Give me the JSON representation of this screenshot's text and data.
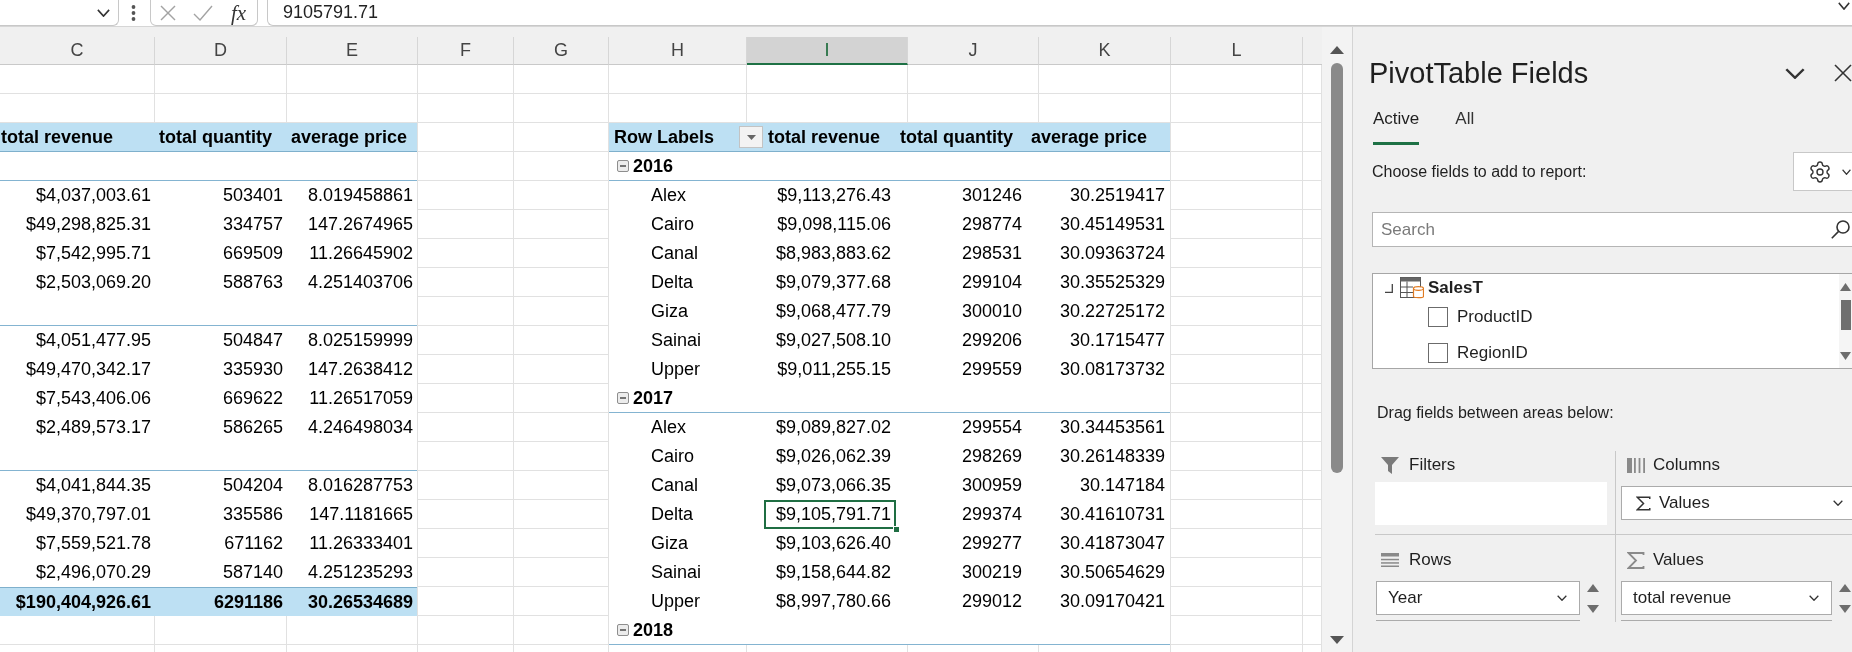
{
  "formula_bar": {
    "function_label": "fx",
    "value": "9105791.71"
  },
  "sheet": {
    "columns": [
      {
        "label": "C",
        "selected": false
      },
      {
        "label": "D",
        "selected": false
      },
      {
        "label": "E",
        "selected": false
      },
      {
        "label": "F",
        "selected": false
      },
      {
        "label": "G",
        "selected": false
      },
      {
        "label": "H",
        "selected": false
      },
      {
        "label": "I",
        "selected": true
      },
      {
        "label": "J",
        "selected": false
      },
      {
        "label": "K",
        "selected": false
      },
      {
        "label": "L",
        "selected": false
      }
    ],
    "left_pivot": {
      "headers": [
        "total revenue",
        "total quantity",
        "average price"
      ],
      "groups": [
        {
          "rows": [
            [
              "$4,037,003.61",
              "503401",
              "8.019458861"
            ],
            [
              "$49,298,825.31",
              "334757",
              "147.2674965"
            ],
            [
              "$7,542,995.71",
              "669509",
              "11.26645902"
            ],
            [
              "$2,503,069.20",
              "588763",
              "4.251403706"
            ]
          ]
        },
        {
          "rows": [
            [
              "$4,051,477.95",
              "504847",
              "8.025159999"
            ],
            [
              "$49,470,342.17",
              "335930",
              "147.2638412"
            ],
            [
              "$7,543,406.06",
              "669622",
              "11.26517059"
            ],
            [
              "$2,489,573.17",
              "586265",
              "4.246498034"
            ]
          ]
        },
        {
          "rows": [
            [
              "$4,041,844.35",
              "504204",
              "8.016287753"
            ],
            [
              "$49,370,797.01",
              "335586",
              "147.1181665"
            ],
            [
              "$7,559,521.78",
              "671162",
              "11.26333401"
            ],
            [
              "$2,496,070.29",
              "587140",
              "4.251235293"
            ]
          ]
        }
      ],
      "grand_total": [
        "$190,404,926.61",
        "6291186",
        "30.26534689"
      ]
    },
    "right_pivot": {
      "row_labels": "Row Labels",
      "headers": [
        "total revenue",
        "total quantity",
        "average price"
      ],
      "groups": [
        {
          "label": "2016",
          "expanded": true,
          "rows": [
            {
              "label": "Alex",
              "cells": [
                {
                  "text": "$9,113,276.43",
                  "selected": false
                },
                {
                  "text": "301246",
                  "selected": false
                },
                {
                  "text": "30.2519417",
                  "selected": false
                }
              ]
            },
            {
              "label": "Cairo",
              "cells": [
                {
                  "text": "$9,098,115.06",
                  "selected": false
                },
                {
                  "text": "298774",
                  "selected": false
                },
                {
                  "text": "30.45149531",
                  "selected": false
                }
              ]
            },
            {
              "label": "Canal",
              "cells": [
                {
                  "text": "$8,983,883.62",
                  "selected": false
                },
                {
                  "text": "298531",
                  "selected": false
                },
                {
                  "text": "30.09363724",
                  "selected": false
                }
              ]
            },
            {
              "label": "Delta",
              "cells": [
                {
                  "text": "$9,079,377.68",
                  "selected": false
                },
                {
                  "text": "299104",
                  "selected": false
                },
                {
                  "text": "30.35525329",
                  "selected": false
                }
              ]
            },
            {
              "label": "Giza",
              "cells": [
                {
                  "text": "$9,068,477.79",
                  "selected": false
                },
                {
                  "text": "300010",
                  "selected": false
                },
                {
                  "text": "30.22725172",
                  "selected": false
                }
              ]
            },
            {
              "label": "Sainai",
              "cells": [
                {
                  "text": "$9,027,508.10",
                  "selected": false
                },
                {
                  "text": "299206",
                  "selected": false
                },
                {
                  "text": "30.1715477",
                  "selected": false
                }
              ]
            },
            {
              "label": "Upper",
              "cells": [
                {
                  "text": "$9,011,255.15",
                  "selected": false
                },
                {
                  "text": "299559",
                  "selected": false
                },
                {
                  "text": "30.08173732",
                  "selected": false
                }
              ]
            }
          ]
        },
        {
          "label": "2017",
          "expanded": true,
          "rows": [
            {
              "label": "Alex",
              "cells": [
                {
                  "text": "$9,089,827.02",
                  "selected": false
                },
                {
                  "text": "299554",
                  "selected": false
                },
                {
                  "text": "30.34453561",
                  "selected": false
                }
              ]
            },
            {
              "label": "Cairo",
              "cells": [
                {
                  "text": "$9,026,062.39",
                  "selected": false
                },
                {
                  "text": "298269",
                  "selected": false
                },
                {
                  "text": "30.26148339",
                  "selected": false
                }
              ]
            },
            {
              "label": "Canal",
              "cells": [
                {
                  "text": "$9,073,066.35",
                  "selected": false
                },
                {
                  "text": "300959",
                  "selected": false
                },
                {
                  "text": "30.147184",
                  "selected": false
                }
              ]
            },
            {
              "label": "Delta",
              "cells": [
                {
                  "text": "$9,105,791.71",
                  "selected": true
                },
                {
                  "text": "299374",
                  "selected": false
                },
                {
                  "text": "30.41610731",
                  "selected": false
                }
              ]
            },
            {
              "label": "Giza",
              "cells": [
                {
                  "text": "$9,103,626.40",
                  "selected": false
                },
                {
                  "text": "299277",
                  "selected": false
                },
                {
                  "text": "30.41873047",
                  "selected": false
                }
              ]
            },
            {
              "label": "Sainai",
              "cells": [
                {
                  "text": "$9,158,644.82",
                  "selected": false
                },
                {
                  "text": "300219",
                  "selected": false
                },
                {
                  "text": "30.50654629",
                  "selected": false
                }
              ]
            },
            {
              "label": "Upper",
              "cells": [
                {
                  "text": "$8,997,780.66",
                  "selected": false
                },
                {
                  "text": "299012",
                  "selected": false
                },
                {
                  "text": "30.09170421",
                  "selected": false
                }
              ]
            }
          ]
        },
        {
          "label": "2018",
          "expanded": true
        }
      ]
    }
  },
  "pivot_panel": {
    "title": "PivotTable Fields",
    "tabs": [
      {
        "label": "Active",
        "selected": true
      },
      {
        "label": "All",
        "selected": false
      }
    ],
    "fields_prompt": "Choose fields to add to report:",
    "search": {
      "placeholder": "Search"
    },
    "field_list": {
      "table": "SalesT",
      "fields": [
        {
          "label": "ProductID",
          "checked": false
        },
        {
          "label": "RegionID",
          "checked": false
        }
      ]
    },
    "areas_prompt": "Drag fields between areas below:",
    "areas": [
      {
        "kind": "filters",
        "label": "Filters"
      },
      {
        "kind": "columns",
        "label": "Columns",
        "items": [
          {
            "kind": "values",
            "label": "Values"
          }
        ]
      },
      {
        "kind": "rows",
        "label": "Rows",
        "items": [
          {
            "kind": "field",
            "label": "Year"
          }
        ]
      },
      {
        "kind": "values",
        "label": "Values",
        "items": [
          {
            "kind": "field",
            "label": "total revenue"
          }
        ]
      }
    ]
  }
}
